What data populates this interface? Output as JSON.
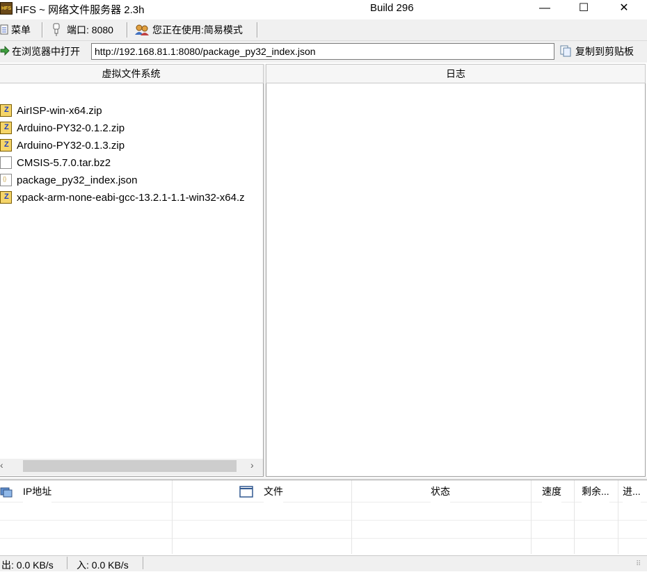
{
  "window": {
    "title": "HFS ~ 网络文件服务器 2.3h",
    "build": "Build 296",
    "icon_name": "hfs-app-icon",
    "icon_text": "HFS",
    "min_glyph": "—",
    "max_glyph": "☐",
    "close_glyph": "✕"
  },
  "toolbar": {
    "menu_label": "菜单",
    "port_label": "端口: 8080",
    "mode_label": "您正在使用:简易模式",
    "open_browser_label": "在浏览器中打开",
    "url_value": "http://192.168.81.1:8080/package_py32_index.json",
    "copy_label": "复制到剪贴板"
  },
  "panels": {
    "vfs_title": "虚拟文件系统",
    "log_title": "日志"
  },
  "files": [
    {
      "name": "AirISP-win-x64.zip",
      "icon": "zip-file-icon"
    },
    {
      "name": "Arduino-PY32-0.1.2.zip",
      "icon": "zip-file-icon"
    },
    {
      "name": "Arduino-PY32-0.1.3.zip",
      "icon": "zip-file-icon"
    },
    {
      "name": "CMSIS-5.7.0.tar.bz2",
      "icon": "generic-file-icon"
    },
    {
      "name": "package_py32_index.json",
      "icon": "json-file-icon"
    },
    {
      "name": "xpack-arm-none-eabi-gcc-13.2.1-1.1-win32-x64.z",
      "icon": "zip-file-icon"
    }
  ],
  "connections": {
    "columns": [
      "IP地址",
      "文件",
      "状态",
      "速度",
      "剩余...",
      "进..."
    ]
  },
  "status": {
    "out_label": "出: 0.0 KB/s",
    "in_label": "入: 0.0 KB/s"
  },
  "colors": {
    "toolbar_bg": "#f0f0f0",
    "zip_icon": "#f5d56a",
    "title_bar_bg": "#ffffff"
  }
}
